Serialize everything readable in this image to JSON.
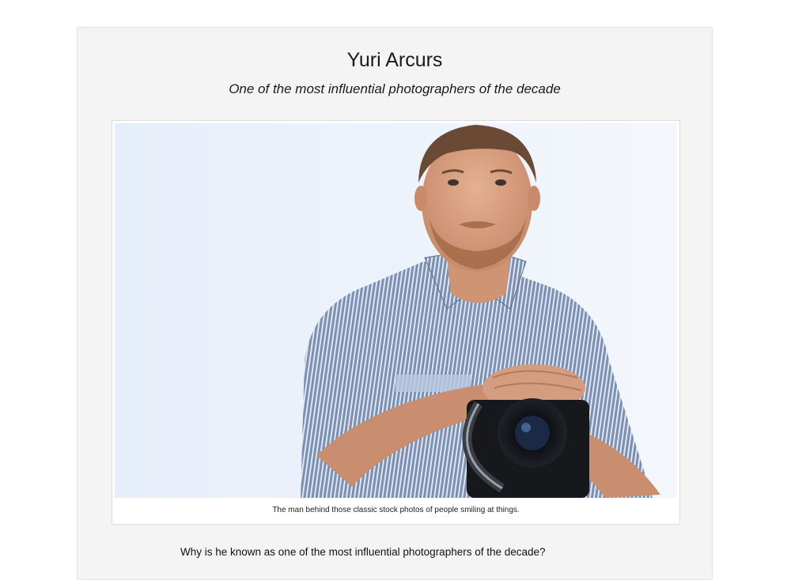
{
  "article": {
    "title": "Yuri Arcurs",
    "subtitle": "One of the most influential photographers of the decade",
    "figure": {
      "image_subject": "man in striped shirt holding camera",
      "caption": "The man behind those classic stock photos of people smiling at things."
    },
    "question": "Why is he known as one of the most influential photographers of the decade?"
  },
  "colors": {
    "page_background": "#ffffff",
    "card_background": "#f4f4f4",
    "card_border": "#e2e2e2",
    "text": "#1a1a1a",
    "photo_background": "#e9f0fa"
  }
}
